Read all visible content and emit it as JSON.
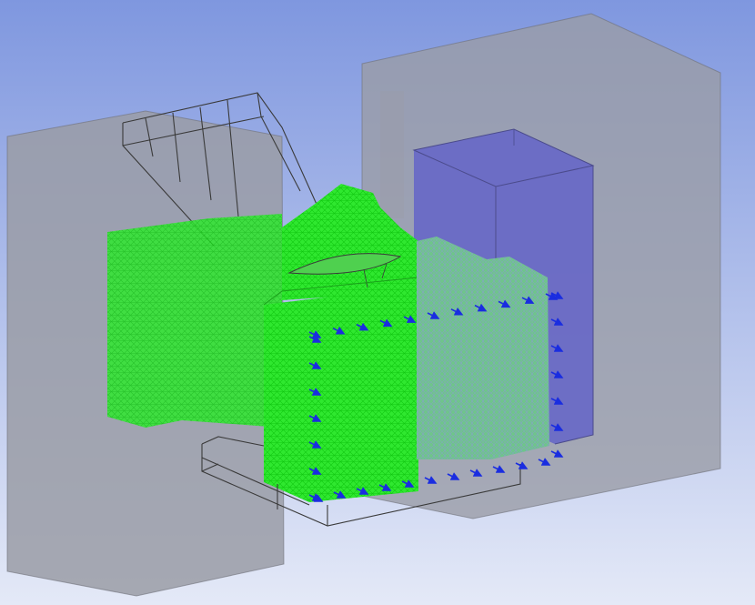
{
  "viewport": {
    "background_top": "#7f97df",
    "background_bottom": "#e4e9f7"
  },
  "colors": {
    "solid_body": "#9a9ca6",
    "solid_body_edge": "#6e7078",
    "mesh_fill": "#2fe82f",
    "mesh_line": "#12c812",
    "mesh_dense_fill": "#6fc48c",
    "enclosure_fill": "#6464c8",
    "enclosure_edge": "#4b4b8c",
    "arrow": "#1a2de0",
    "wire": "#3a3a3a"
  },
  "icons": {
    "load_arrow": "arrow-icon"
  }
}
